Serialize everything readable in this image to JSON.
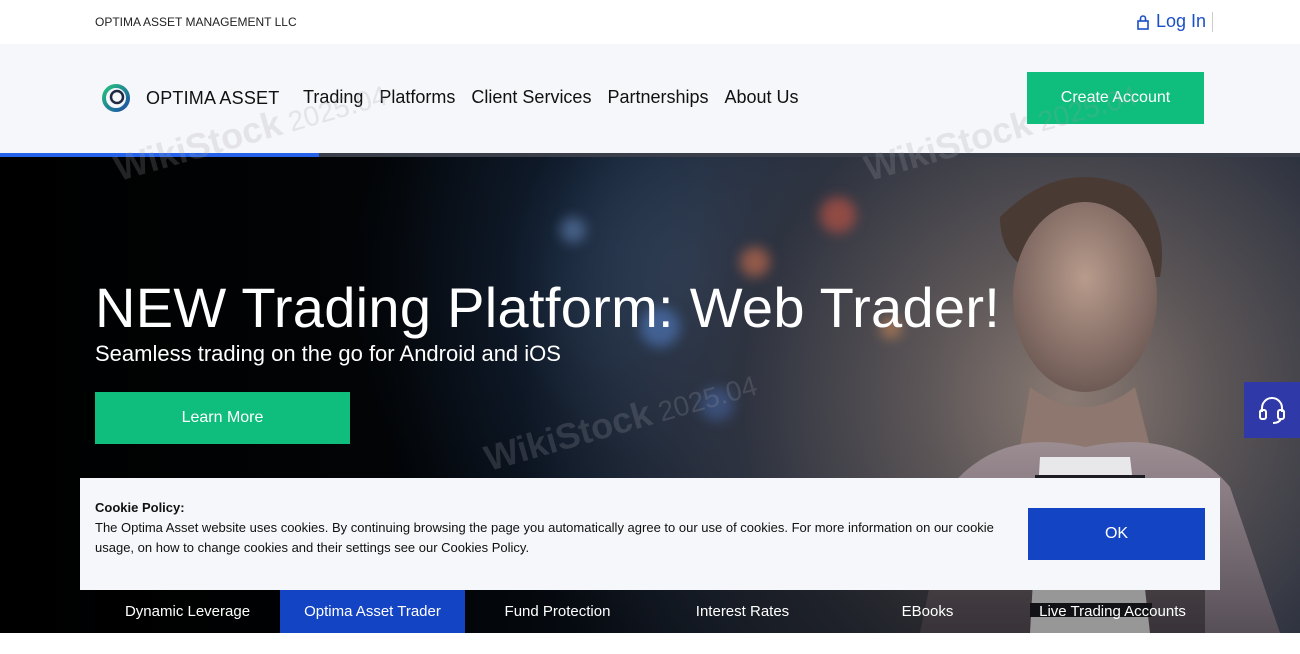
{
  "topbar": {
    "company": "OPTIMA ASSET MANAGEMENT LLC",
    "login_label": "Log In"
  },
  "navbar": {
    "brand": "OPTIMA ASSET",
    "menu": [
      "Trading",
      "Platforms",
      "Client Services",
      "Partnerships",
      "About Us"
    ],
    "create_account_label": "Create Account"
  },
  "slider": {
    "progress_fraction": 0.245
  },
  "hero": {
    "title": "NEW Trading Platform: Web Trader!",
    "subtitle": "Seamless trading on the go for Android and iOS",
    "learn_more_label": "Learn More"
  },
  "cookie": {
    "title": "Cookie Policy:",
    "text": "The Optima Asset website uses cookies. By continuing browsing the page you automatically agree to our use of cookies. For more information on our cookie usage, on how to change cookies and their settings see our Cookies Policy.",
    "ok_label": "OK"
  },
  "tabs": {
    "items": [
      "Dynamic Leverage",
      "Optima Asset Trader",
      "Fund Protection",
      "Interest Rates",
      "EBooks",
      "Live Trading Accounts"
    ],
    "active_index": 1
  },
  "watermark": {
    "brand": "WikiStock",
    "date": "2025.04"
  },
  "colors": {
    "accent_green": "#0fbd7c",
    "accent_blue": "#1344c3",
    "link_blue": "#1a4fc7",
    "support_purple": "#2f3aa8"
  },
  "icons": {
    "login": "lock-icon",
    "logo": "optima-logo-icon",
    "support": "headset-icon"
  }
}
